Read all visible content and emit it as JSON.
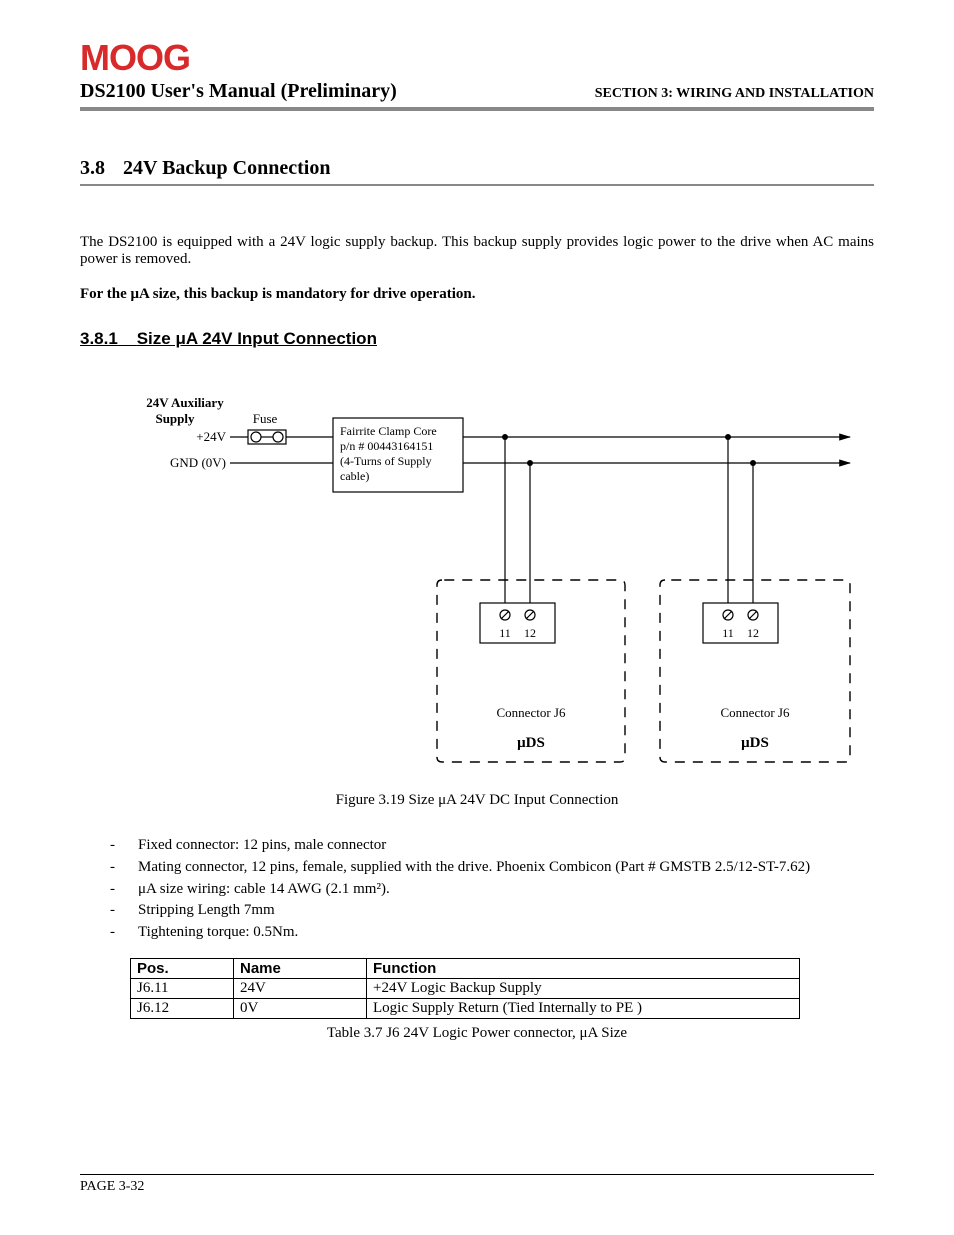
{
  "logo_text": "MOOG",
  "header": {
    "left": "DS2100 User's Manual (Preliminary)",
    "right": "SECTION 3: WIRING AND INSTALLATION"
  },
  "section": {
    "number": "3.8",
    "title": "24V Backup Connection"
  },
  "paragraph1": "The DS2100 is equipped with a 24V logic supply backup. This backup supply provides logic power to the drive when AC mains power is removed.",
  "bold_note": "For the μA size, this backup is mandatory for drive operation.",
  "subsection": {
    "number": "3.8.1",
    "title": "Size μA 24V Input Connection"
  },
  "diagram": {
    "supply_title_1": "24V Auxiliary",
    "supply_title_2": "Supply",
    "fuse_label": "Fuse",
    "plus24v": "+24V",
    "gnd": "GND (0V)",
    "box_line1": "Fairrite Clamp Core",
    "box_line2": "p/n # 00443164151",
    "box_line3": "(4-Turns of Supply",
    "box_line4": "cable)",
    "pin11": "11",
    "pin12": "12",
    "connector_label": "Connector J6",
    "uds_label": "μDS"
  },
  "figure_caption": "Figure 3.19 Size μA 24V DC Input Connection",
  "bullets": [
    "Fixed connector: 12 pins, male connector",
    "Mating connector, 12 pins, female, supplied with the drive. Phoenix Combicon (Part # GMSTB 2.5/12-ST-7.62)",
    "μA size wiring: cable 14 AWG (2.1 mm²).",
    "Stripping Length 7mm",
    "Tightening torque: 0.5Nm."
  ],
  "table": {
    "headers": [
      "Pos.",
      "Name",
      "Function"
    ],
    "rows": [
      [
        "J6.11",
        "24V",
        "+24V Logic Backup Supply"
      ],
      [
        "J6.12",
        "0V",
        "Logic Supply Return (Tied Internally to PE )"
      ]
    ]
  },
  "table_caption": "Table 3.7 J6 24V Logic Power connector, μA Size",
  "footer": "PAGE 3-32"
}
